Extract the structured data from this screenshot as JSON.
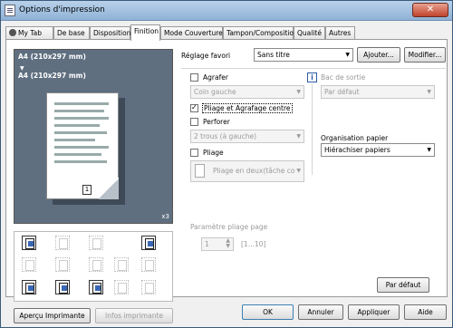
{
  "window": {
    "title": "Options d'impression",
    "close_icon": "close-icon"
  },
  "tabs": [
    {
      "label": "My Tab",
      "icon": "person-icon"
    },
    {
      "label": "De base"
    },
    {
      "label": "Disposition"
    },
    {
      "label": "Finition"
    },
    {
      "label": "Mode Couverture"
    },
    {
      "label": "Tampon/Composition"
    },
    {
      "label": "Qualité"
    },
    {
      "label": "Autres"
    }
  ],
  "active_tab": "Finition",
  "preview": {
    "paper_top": "A4 (210x297 mm)",
    "paper_bottom": "A4 (210x297 mm)",
    "copies": "x3",
    "page_number": "1"
  },
  "favorites": {
    "label": "Réglage favori",
    "value": "Sans titre",
    "add_button": "Ajouter...",
    "modify_button": "Modifier..."
  },
  "staple": {
    "label": "Agrafer",
    "checked": false,
    "position": "Coin gauche"
  },
  "fold_staple": {
    "label": "Pliage et Agrafage centre",
    "checked": true
  },
  "punch": {
    "label": "Perforer",
    "checked": false,
    "option": "2 trous (à gauche)"
  },
  "fold": {
    "label": "Pliage",
    "checked": false,
    "option": "Pliage en deux(tâche co"
  },
  "output_tray": {
    "label": "Bac de sortie",
    "value": "Par défaut"
  },
  "paper_arrangement": {
    "label": "Organisation papier",
    "value": "Hiérachiser papiers"
  },
  "fold_setting": {
    "label": "Paramètre pliage page",
    "value": "1",
    "range": "[1...10]"
  },
  "bottom_pane_buttons": {
    "printer_view": "Aperçu Imprimante",
    "printer_info": "Infos imprimante"
  },
  "default_button": "Par défaut",
  "dialog_buttons": {
    "ok": "OK",
    "cancel": "Annuler",
    "apply": "Appliquer",
    "help": "Aide"
  },
  "colors": {
    "titlebar": "#a9c4e1",
    "preview_bg": "#5f6f80",
    "close_button": "#c0442c"
  }
}
